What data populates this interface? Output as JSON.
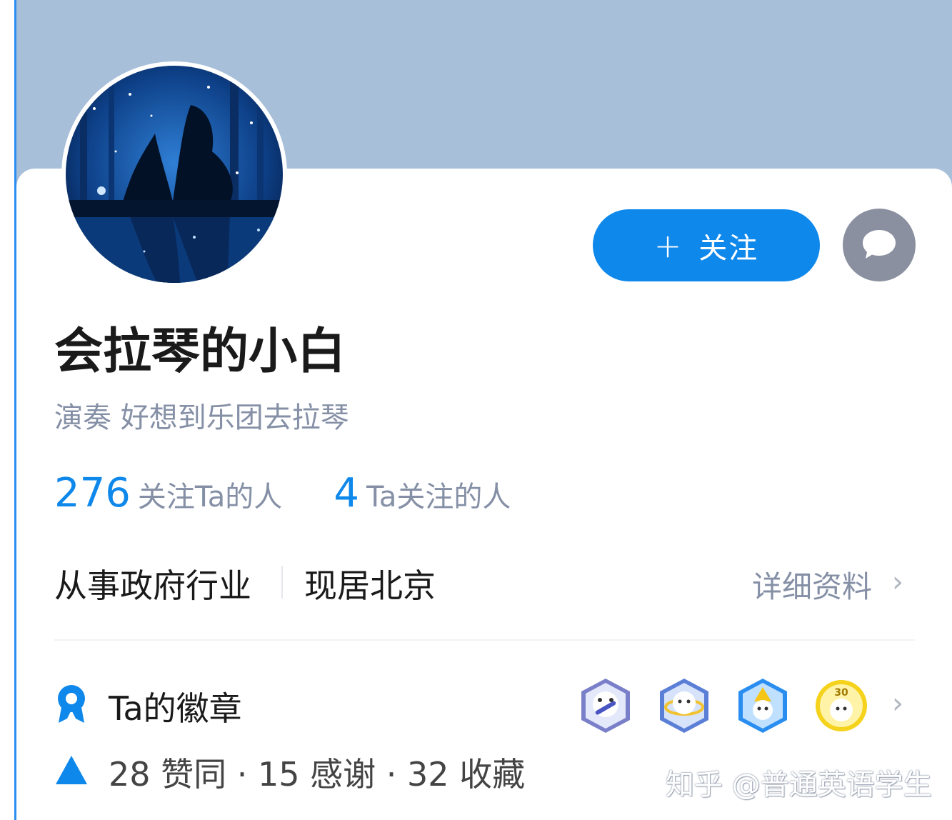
{
  "profile": {
    "name": "会拉琴的小白",
    "headline": "演奏 好想到乐团去拉琴",
    "followers": {
      "count": "276",
      "label": "关注Ta的人"
    },
    "following": {
      "count": "4",
      "label": "Ta关注的人"
    },
    "industry": "从事政府行业",
    "location": "现居北京",
    "detail_link": "详细资料"
  },
  "actions": {
    "follow_label": "关注",
    "follow_prefix": "+"
  },
  "badges": {
    "title": "Ta的徽章",
    "items": [
      "badge-1",
      "badge-2",
      "badge-3",
      "badge-30"
    ],
    "badge4_text": "30"
  },
  "achievements": {
    "text": "28 赞同 · 15 感谢 · 32 收藏"
  },
  "watermark": "知乎 @普通英语学生",
  "colors": {
    "cover": "#a7bfd9",
    "accent": "#0f88eb",
    "message_button": "#8b90a0",
    "secondary_text": "#8590a6"
  }
}
